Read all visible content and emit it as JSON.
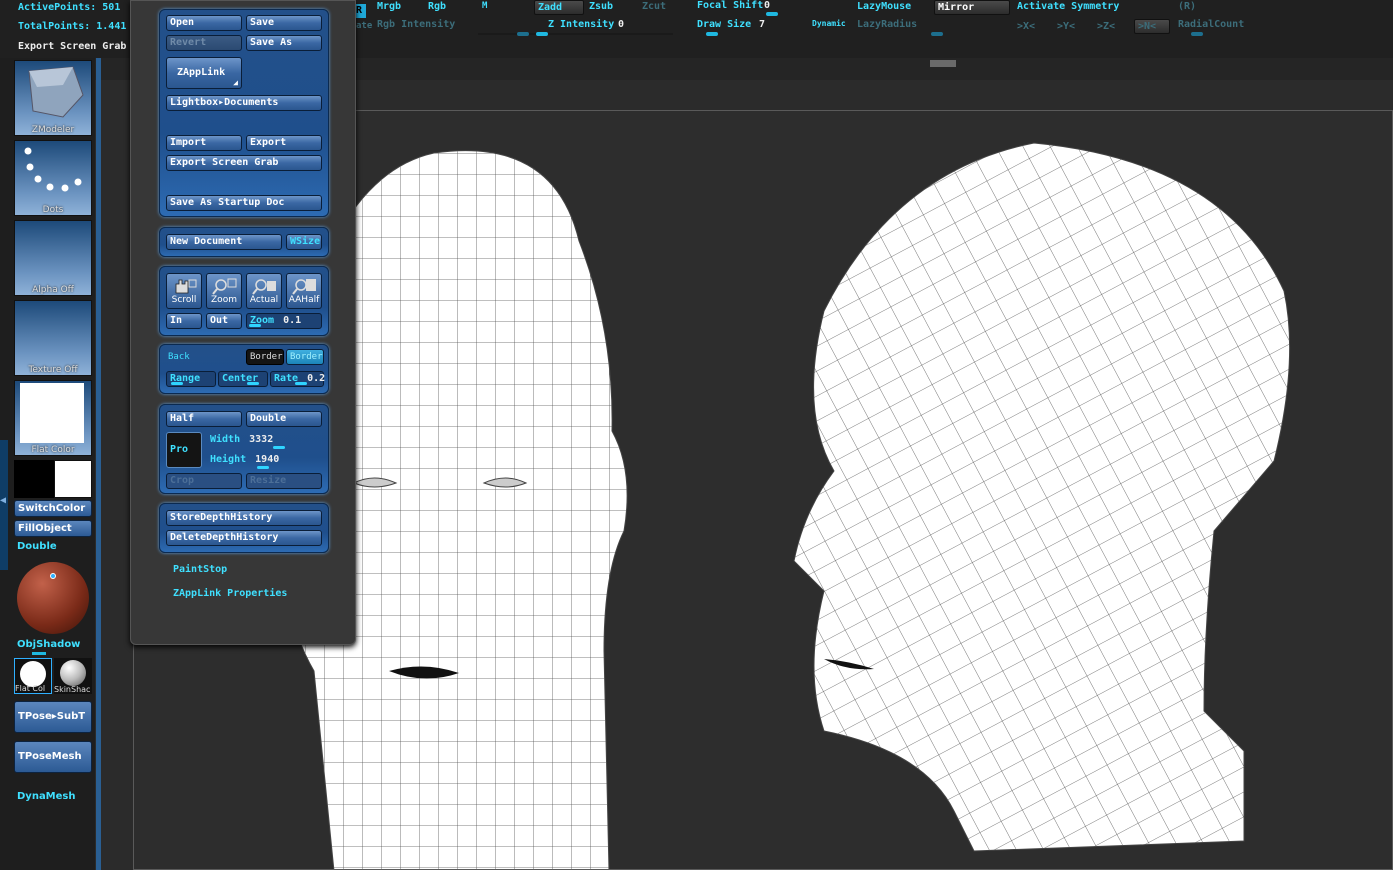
{
  "topbar": {
    "active_points": "ActivePoints: 501",
    "total_points": "TotalPoints: 1.441",
    "export_screen_grab": "Export Screen Grab",
    "mrgb": "Mrgb",
    "rgb": "Rgb",
    "m": "M",
    "zadd": "Zadd",
    "zsub": "Zsub",
    "zcut": "Zcut",
    "rgb_intensity": "Rgb Intensity",
    "z_intensity_label": "Z Intensity",
    "z_intensity_value": "0",
    "focal_shift_label": "Focal Shift",
    "focal_shift_value": "0",
    "draw_size_label": "Draw Size",
    "draw_size_value": "7",
    "dynamic": "Dynamic",
    "lazymouse": "LazyMouse",
    "lazyradius": "LazyRadius",
    "mirror": "Mirror",
    "activate_symmetry": "Activate Symmetry",
    "r_toggle": "(R)",
    "axis_x": ">X<",
    "axis_y": ">Y<",
    "axis_z": ">Z<",
    "axis_n": ">N<",
    "radial_count": "RadialCount",
    "ate_fragment": "ate"
  },
  "left_shelf": {
    "zmodeler": "ZModeler",
    "dots": "Dots",
    "alpha_off": "Alpha  Off",
    "texture_off": "Texture  Off",
    "flat_color": "Flat  Color",
    "switch_color": "SwitchColor",
    "fill_object": "FillObject",
    "double": "Double",
    "obj_shadow": "ObjShadow",
    "flat_col": "Flat  Col",
    "skin_shade": "SkinShac",
    "tpose_subt": "TPose▸SubT",
    "tpose_mesh": "TPoseMesh",
    "dynamesh": "DynaMesh"
  },
  "document_menu": {
    "open": "Open",
    "save": "Save",
    "revert": "Revert",
    "save_as": "Save As",
    "zapplink": "ZAppLink",
    "lightbox_documents": "Lightbox▸Documents",
    "import": "Import",
    "export": "Export",
    "export_screen_grab": "Export Screen Grab",
    "save_as_startup_doc": "Save As Startup Doc",
    "new_document": "New Document",
    "wsize": "WSize",
    "scroll": "Scroll",
    "zoom": "Zoom",
    "actual": "Actual",
    "aahalf": "AAHalf",
    "in": "In",
    "out": "Out",
    "zoom_slider_label": "Zoom",
    "zoom_value": "0.1",
    "back": "Back",
    "border": "Border",
    "border2": "Border2",
    "range": "Range",
    "center": "Center",
    "rate": "Rate",
    "rate_value": "0.2",
    "half": "Half",
    "double": "Double",
    "pro": "Pro",
    "width_label": "Width",
    "width_value": "3332",
    "height_label": "Height",
    "height_value": "1940",
    "crop": "Crop",
    "resize": "Resize",
    "store_depth_history": "StoreDepthHistory",
    "delete_depth_history": "DeleteDepthHistory",
    "paint_stop": "PaintStop",
    "zapplink_properties": "ZAppLink Properties"
  },
  "colors": {
    "accent_cyan": "#3fe0ff",
    "button_blue": "#2c5a94",
    "background": "#2b2b2b"
  }
}
